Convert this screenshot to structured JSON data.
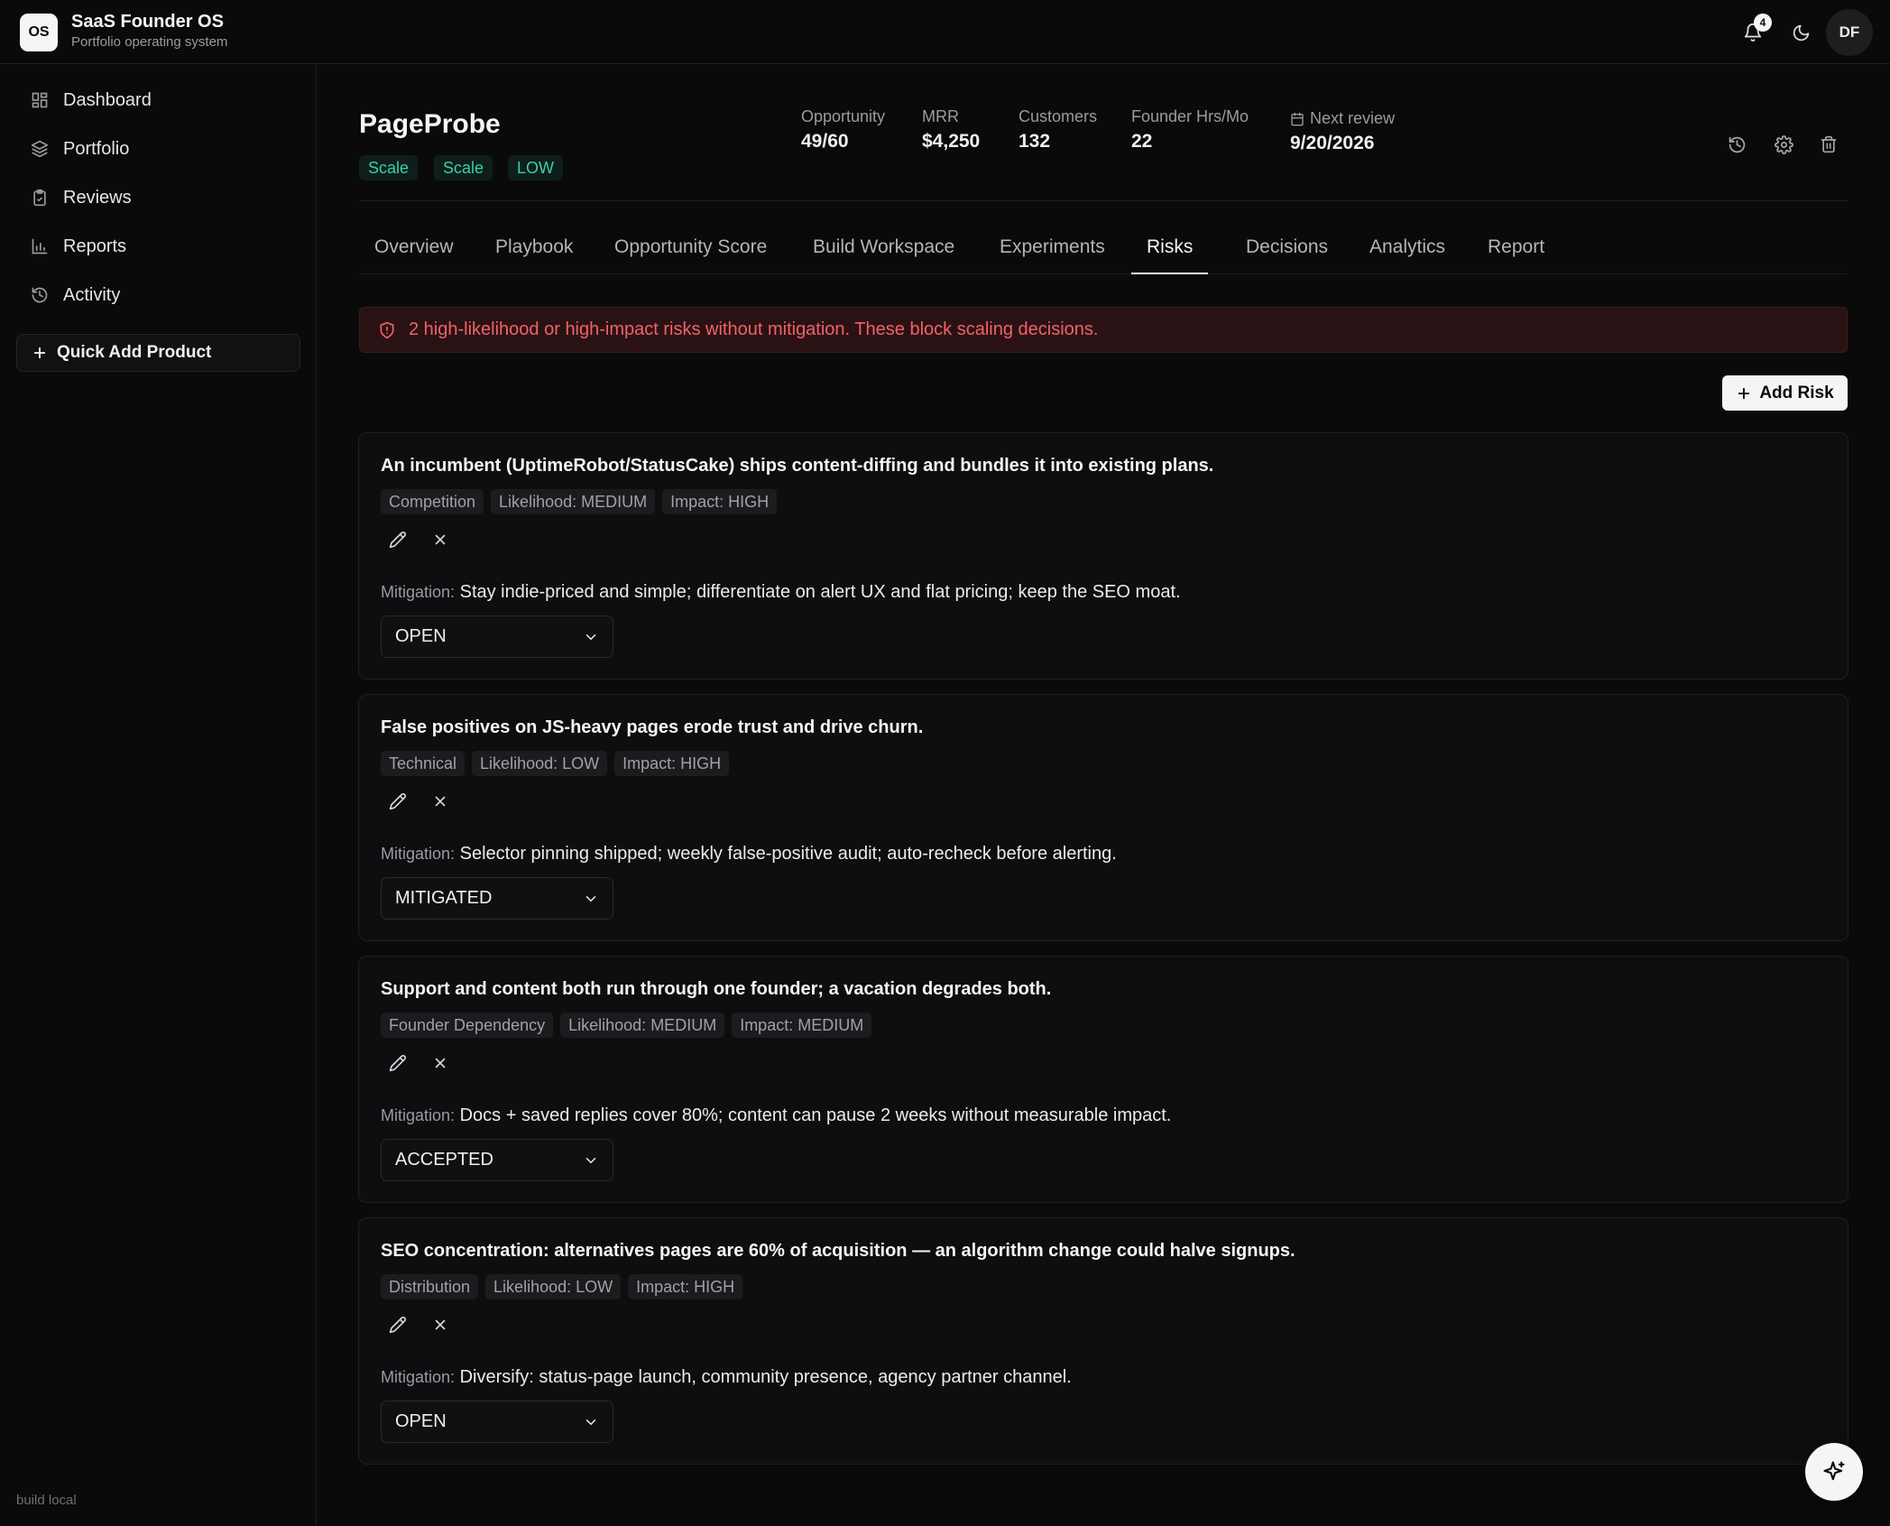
{
  "app": {
    "logo": "OS",
    "title": "SaaS Founder OS",
    "subtitle": "Portfolio operating system",
    "notification_count": "4",
    "avatar_initials": "DF"
  },
  "sidebar": {
    "items": [
      {
        "label": "Dashboard",
        "icon": "dashboard-icon"
      },
      {
        "label": "Portfolio",
        "icon": "layers-icon"
      },
      {
        "label": "Reviews",
        "icon": "clipboard-icon"
      },
      {
        "label": "Reports",
        "icon": "bar-chart-icon"
      },
      {
        "label": "Activity",
        "icon": "history-icon"
      }
    ],
    "quick_add": "Quick Add Product",
    "build": "build local"
  },
  "product": {
    "name": "PageProbe",
    "tags": [
      "Scale",
      "Scale",
      "LOW"
    ],
    "metrics": [
      {
        "label": "Opportunity",
        "value": "49/60"
      },
      {
        "label": "MRR",
        "value": "$4,250"
      },
      {
        "label": "Customers",
        "value": "132"
      },
      {
        "label": "Founder Hrs/Mo",
        "value": "22"
      }
    ],
    "next_review_label": "Next review",
    "next_review_value": "9/20/2026"
  },
  "tabs": {
    "items": [
      "Overview",
      "Playbook",
      "Opportunity Score",
      "Build Workspace",
      "Experiments",
      "Risks",
      "Decisions",
      "Analytics",
      "Report"
    ],
    "active": "Risks"
  },
  "alert": {
    "text": "2 high-likelihood or high-impact risks without mitigation. These block scaling decisions."
  },
  "add_risk_label": "Add Risk",
  "mitigation_label": "Mitigation:",
  "risks": [
    {
      "title": "An incumbent (UptimeRobot/StatusCake) ships content-diffing and bundles it into existing plans.",
      "category": "Competition",
      "likelihood": "Likelihood: MEDIUM",
      "impact": "Impact: HIGH",
      "mitigation": "Stay indie-priced and simple; differentiate on alert UX and flat pricing; keep the SEO moat.",
      "status": "OPEN"
    },
    {
      "title": "False positives on JS-heavy pages erode trust and drive churn.",
      "category": "Technical",
      "likelihood": "Likelihood: LOW",
      "impact": "Impact: HIGH",
      "mitigation": "Selector pinning shipped; weekly false-positive audit; auto-recheck before alerting.",
      "status": "MITIGATED"
    },
    {
      "title": "Support and content both run through one founder; a vacation degrades both.",
      "category": "Founder Dependency",
      "likelihood": "Likelihood: MEDIUM",
      "impact": "Impact: MEDIUM",
      "mitigation": "Docs + saved replies cover 80%; content can pause 2 weeks without measurable impact.",
      "status": "ACCEPTED"
    },
    {
      "title": "SEO concentration: alternatives pages are 60% of acquisition — an algorithm change could halve signups.",
      "category": "Distribution",
      "likelihood": "Likelihood: LOW",
      "impact": "Impact: HIGH",
      "mitigation": "Diversify: status-page launch, community presence, agency partner channel.",
      "status": "OPEN"
    }
  ],
  "colors": {
    "background": "#0a0a0b",
    "accent_green": "#34d3a6",
    "alert_red": "#f0626a"
  }
}
